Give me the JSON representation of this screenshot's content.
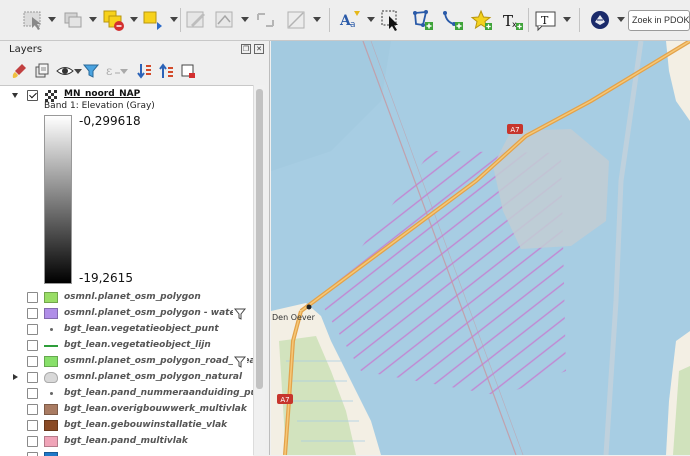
{
  "toolbar": {
    "search_placeholder": "Zoek in PDOK",
    "buttons": [
      "select-features-icon",
      "deselect-icon",
      "select-layer-icon",
      "identify-icon",
      "edit-pencil-icon",
      "digitize-icon",
      "vertex-tool-icon",
      "node-tool-icon",
      "label-abc-icon",
      "select-label-icon",
      "add-polygon-icon",
      "add-line-icon",
      "star-icon",
      "text-annotation-icon",
      "text-box-icon",
      "plugin-globe-icon"
    ]
  },
  "panel": {
    "title": "Layers",
    "float_btn": "❐",
    "close_btn": "✕"
  },
  "raster": {
    "name": "MN_noord_NAP",
    "band": "Band 1: Elevation (Gray)",
    "max": "-0,299618",
    "min": "-19,2615"
  },
  "layers": [
    {
      "name": "osmnl.planet_osm_polygon",
      "color": "#99dd66",
      "style": "box",
      "filter": false,
      "expander": "none"
    },
    {
      "name": "osmnl.planet_osm_polygon - water",
      "color": "#b08ee8",
      "style": "box",
      "filter": true,
      "expander": "none"
    },
    {
      "name": "bgt_lean.vegetatieobject_punt",
      "color": "#666666",
      "style": "dot",
      "filter": false,
      "expander": "none"
    },
    {
      "name": "bgt_lean.vegetatieobject_lijn",
      "color": "#2e9e3a",
      "style": "line",
      "filter": false,
      "expander": "none"
    },
    {
      "name": "osmnl.planet_osm_polygon_road_area",
      "color": "#88e06a",
      "style": "box",
      "filter": true,
      "expander": "none"
    },
    {
      "name": "osmnl.planet_osm_polygon_natural",
      "color": "#d8d8d8",
      "style": "cloud",
      "filter": false,
      "expander": "right"
    },
    {
      "name": "bgt_lean.pand_nummeraanduiding_punt",
      "color": "#666666",
      "style": "dot",
      "filter": false,
      "expander": "none"
    },
    {
      "name": "bgt_lean.overigbouwwerk_multivlak",
      "color": "#a97b62",
      "style": "box",
      "filter": false,
      "expander": "none"
    },
    {
      "name": "bgt_lean.gebouwinstallatie_vlak",
      "color": "#8a4a25",
      "style": "box",
      "filter": false,
      "expander": "none"
    },
    {
      "name": "bgt_lean.pand_multivlak",
      "color": "#f0a4b8",
      "style": "box",
      "filter": false,
      "expander": "none"
    },
    {
      "name": "",
      "color": "#1f78c8",
      "style": "box",
      "filter": false,
      "expander": "none"
    }
  ],
  "map": {
    "road_label": "A7",
    "road_label_2": "A7",
    "place_label": "Den Oever",
    "water_color": "#a7cde3",
    "land_color": "#f3efe4",
    "road_color": "#e3a24a",
    "hatch_color": "#c77bd0"
  }
}
